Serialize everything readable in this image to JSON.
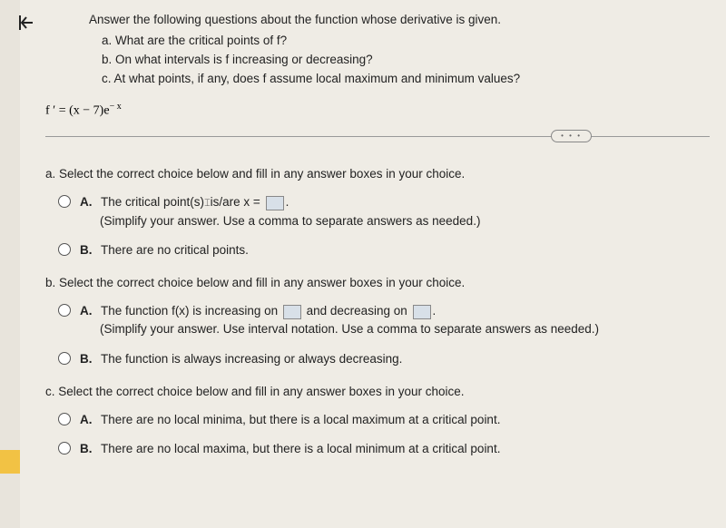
{
  "header": {
    "intro": "Answer the following questions about the function whose derivative is given.",
    "qa": "a. What are the critical points of f?",
    "qb": "b. On what intervals is f increasing or decreasing?",
    "qc": "c. At what points, if any, does f assume local maximum and minimum values?"
  },
  "formula": {
    "lhs": "f ′ = (x − 7)e",
    "exp": "− x"
  },
  "badge": "• • •",
  "sections": {
    "a": {
      "prompt": "a. Select the correct choice below and fill in any answer boxes in your choice.",
      "choiceA": {
        "label": "A.",
        "line1a": "The critical point(s)",
        "line1b": "is/are x =",
        "period": ".",
        "line2": "(Simplify your answer. Use a comma to separate answers as needed.)"
      },
      "choiceB": {
        "label": "B.",
        "text": "There are no critical points."
      }
    },
    "b": {
      "prompt": "b. Select the correct choice below and fill in any answer boxes in your choice.",
      "choiceA": {
        "label": "A.",
        "text1": "The function f(x) is increasing on",
        "text2": "and decreasing on",
        "period": ".",
        "line2": "(Simplify your answer. Use interval notation. Use a comma to separate answers as needed.)"
      },
      "choiceB": {
        "label": "B.",
        "text": "The function is always increasing or always decreasing."
      }
    },
    "c": {
      "prompt": "c. Select the correct choice below and fill in any answer boxes in your choice.",
      "choiceA": {
        "label": "A.",
        "text": "There are no local minima, but there is a local maximum at a critical point."
      },
      "choiceB": {
        "label": "B.",
        "text": "There are no local maxima, but there is a local minimum at a critical point."
      }
    }
  }
}
